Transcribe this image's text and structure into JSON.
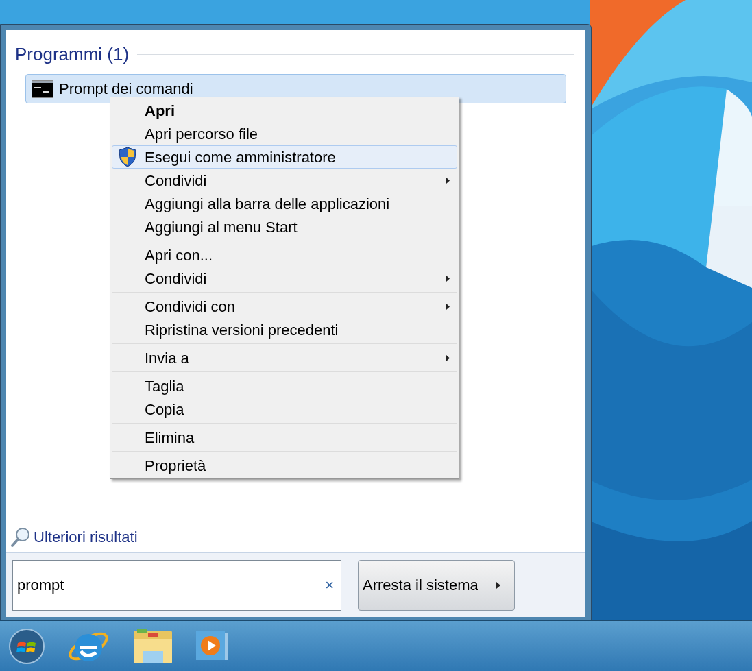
{
  "start_menu": {
    "section_title": "Programmi (1)",
    "results": [
      {
        "label": "Prompt dei comandi",
        "selected": true
      }
    ],
    "more_results": "Ulteriori risultati",
    "search": {
      "value": "prompt",
      "clear": "×"
    },
    "shutdown": {
      "label": "Arresta il sistema"
    }
  },
  "context_menu": {
    "groups": [
      [
        {
          "label": "Apri",
          "kind": "plain",
          "default": true,
          "submenu": false,
          "selected": false
        },
        {
          "label": "Apri percorso file",
          "kind": "plain",
          "default": false,
          "submenu": false,
          "selected": false
        },
        {
          "label": "Esegui come amministratore",
          "kind": "shield",
          "default": false,
          "submenu": false,
          "selected": true
        },
        {
          "label": "Condividi",
          "kind": "plain",
          "default": false,
          "submenu": true,
          "selected": false
        },
        {
          "label": "Aggiungi alla barra delle applicazioni",
          "kind": "plain",
          "default": false,
          "submenu": false,
          "selected": false
        },
        {
          "label": "Aggiungi al menu Start",
          "kind": "plain",
          "default": false,
          "submenu": false,
          "selected": false
        }
      ],
      [
        {
          "label": "Apri con...",
          "kind": "plain",
          "default": false,
          "submenu": false,
          "selected": false
        },
        {
          "label": "Condividi",
          "kind": "plain",
          "default": false,
          "submenu": true,
          "selected": false
        }
      ],
      [
        {
          "label": "Condividi con",
          "kind": "plain",
          "default": false,
          "submenu": true,
          "selected": false
        },
        {
          "label": "Ripristina versioni precedenti",
          "kind": "plain",
          "default": false,
          "submenu": false,
          "selected": false
        }
      ],
      [
        {
          "label": "Invia a",
          "kind": "plain",
          "default": false,
          "submenu": true,
          "selected": false
        }
      ],
      [
        {
          "label": "Taglia",
          "kind": "plain",
          "default": false,
          "submenu": false,
          "selected": false
        },
        {
          "label": "Copia",
          "kind": "plain",
          "default": false,
          "submenu": false,
          "selected": false
        }
      ],
      [
        {
          "label": "Elimina",
          "kind": "plain",
          "default": false,
          "submenu": false,
          "selected": false
        }
      ],
      [
        {
          "label": "Proprietà",
          "kind": "plain",
          "default": false,
          "submenu": false,
          "selected": false
        }
      ]
    ]
  },
  "taskbar": {
    "items": [
      {
        "kind": "start"
      },
      {
        "kind": "browser"
      },
      {
        "kind": "folder"
      },
      {
        "kind": "media"
      }
    ]
  }
}
